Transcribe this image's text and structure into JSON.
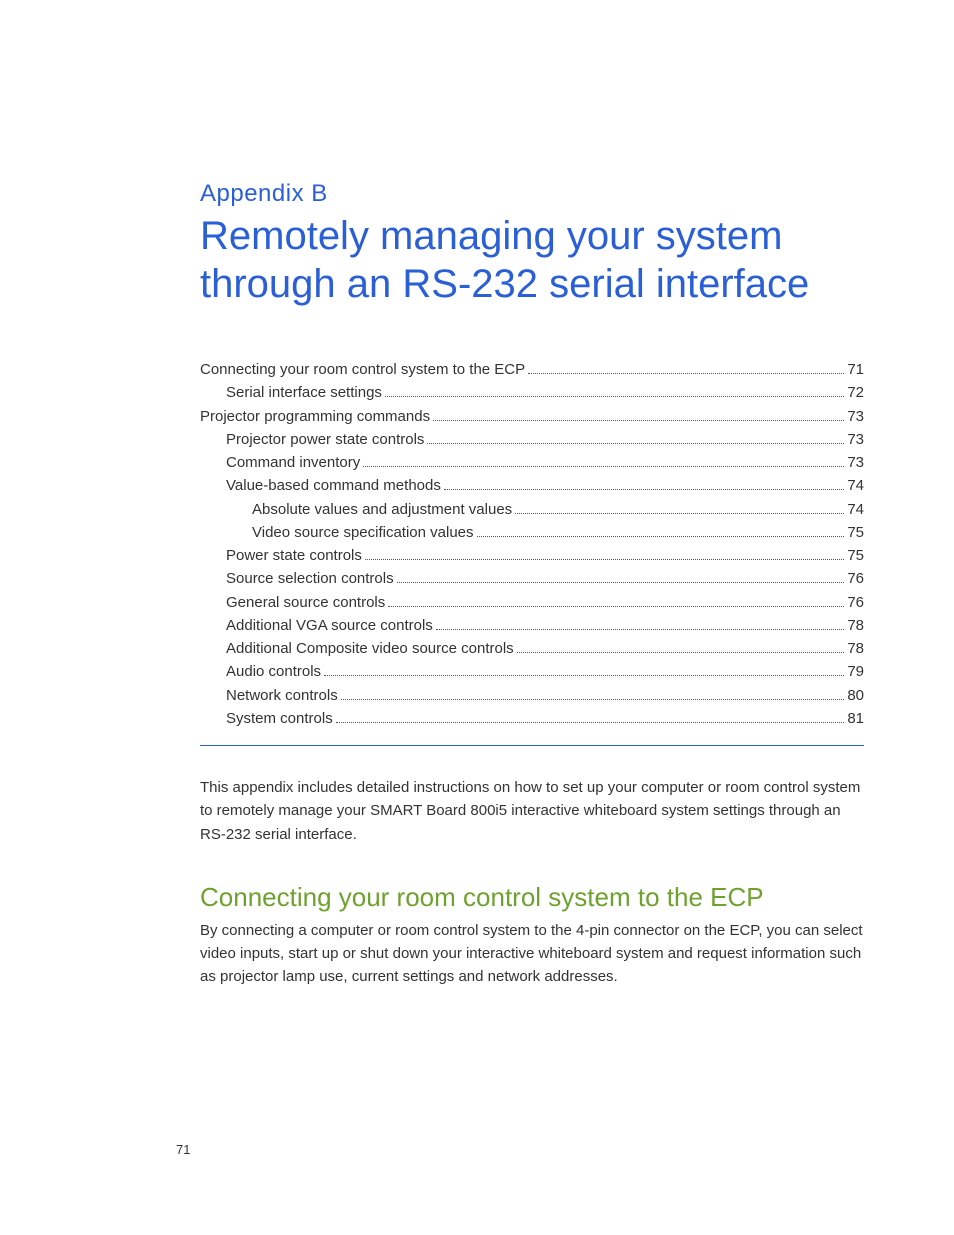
{
  "appendix_label": "Appendix B",
  "title": "Remotely managing your system through an RS-232 serial interface",
  "toc": [
    {
      "label": "Connecting your room control system to the ECP",
      "page": "71",
      "indent": 0
    },
    {
      "label": "Serial interface settings",
      "page": "72",
      "indent": 1
    },
    {
      "label": "Projector programming commands",
      "page": "73",
      "indent": 0
    },
    {
      "label": "Projector power state controls",
      "page": "73",
      "indent": 1
    },
    {
      "label": "Command inventory",
      "page": "73",
      "indent": 1
    },
    {
      "label": "Value-based command methods",
      "page": "74",
      "indent": 1
    },
    {
      "label": "Absolute values and adjustment values",
      "page": "74",
      "indent": 2
    },
    {
      "label": "Video source specification values",
      "page": "75",
      "indent": 2
    },
    {
      "label": "Power state controls",
      "page": "75",
      "indent": 1
    },
    {
      "label": "Source selection controls",
      "page": "76",
      "indent": 1
    },
    {
      "label": "General source controls",
      "page": "76",
      "indent": 1
    },
    {
      "label": "Additional VGA source controls",
      "page": "78",
      "indent": 1
    },
    {
      "label": "Additional Composite video source controls",
      "page": "78",
      "indent": 1
    },
    {
      "label": "Audio controls",
      "page": "79",
      "indent": 1
    },
    {
      "label": "Network controls",
      "page": "80",
      "indent": 1
    },
    {
      "label": "System controls",
      "page": "81",
      "indent": 1
    }
  ],
  "intro_paragraph": "This appendix includes detailed instructions on how to set up your computer or room control system to remotely manage your SMART Board 800i5 interactive whiteboard system settings through an RS-232 serial interface.",
  "section_heading": "Connecting your room control system to the ECP",
  "section_body": "By connecting a computer or room control system to the 4-pin connector on the ECP, you can select video inputs, start up or shut down your interactive whiteboard system and request information such as projector lamp use, current settings and network addresses.",
  "page_number": "71"
}
